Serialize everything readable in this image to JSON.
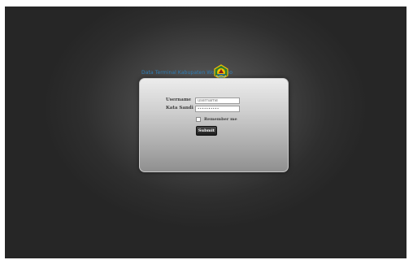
{
  "header": {
    "title": "Data Terminal Kabupaten Wonosobo"
  },
  "login": {
    "username_label": "Username",
    "username_placeholder": "username",
    "password_label": "Kata Sandi",
    "password_value": "••••••••••",
    "remember_label": "Remember me",
    "remember_checked": false,
    "submit_label": "Submit"
  },
  "icons": {
    "logo": "emblem-logo"
  },
  "colors": {
    "title_text": "#2f7fb8",
    "background": "#2e2e2e",
    "button": "#1e1e1e"
  }
}
